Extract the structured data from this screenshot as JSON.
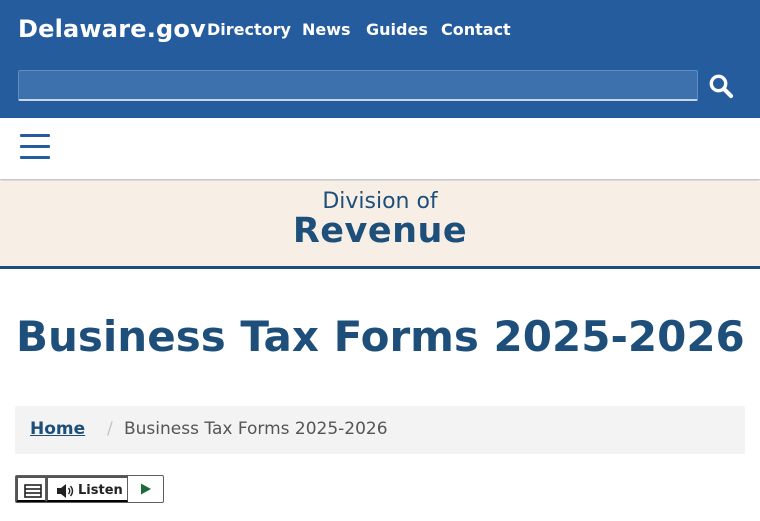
{
  "header": {
    "logo": "Delaware.gov",
    "nav": [
      {
        "label": "Directory"
      },
      {
        "label": "News"
      },
      {
        "label": "Guides"
      },
      {
        "label": "Contact"
      }
    ],
    "search": {
      "value": "",
      "icon": "search-icon"
    }
  },
  "menu": {
    "icon": "hamburger-menu-icon"
  },
  "banner": {
    "line1": "Division of",
    "line2": "Revenue"
  },
  "page": {
    "title": "Business Tax Forms 2025-2026"
  },
  "breadcrumb": {
    "home": "Home",
    "separator": "/",
    "current": "Business Tax Forms 2025-2026"
  },
  "listen": {
    "label": "Listen",
    "icons": [
      "menu-icon",
      "speaker-icon",
      "play-icon"
    ]
  },
  "colors": {
    "header_bg": "#245c9e",
    "brand_blue": "#1d4f7a",
    "banner_bg": "#f7efe5",
    "breadcrumb_bg": "#f3f3f3"
  }
}
